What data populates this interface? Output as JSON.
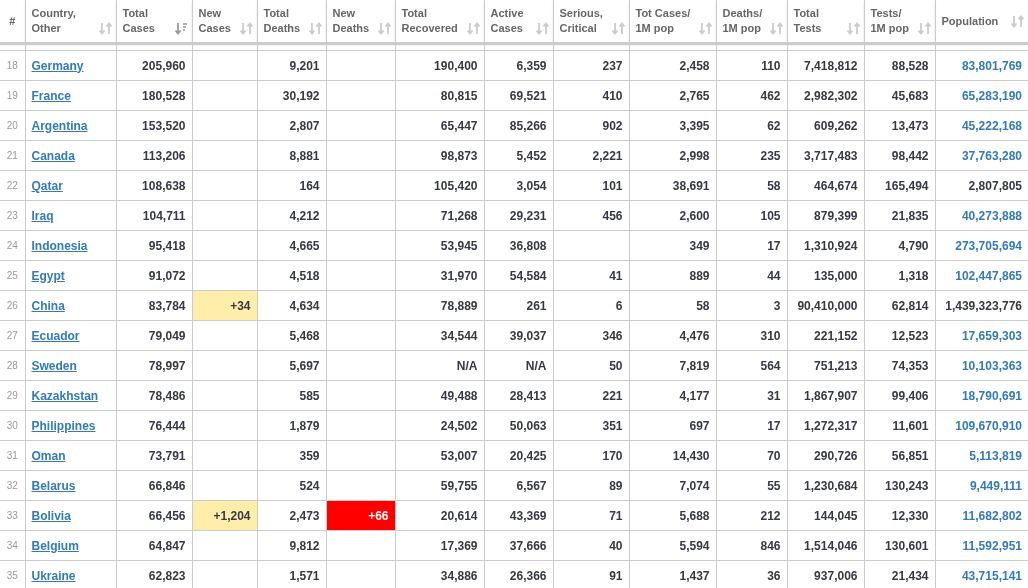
{
  "table": {
    "columns": [
      {
        "label": "#",
        "sortable": false
      },
      {
        "label": "Country,\nOther",
        "sortable": true,
        "sorted": false
      },
      {
        "label": "Total\nCases",
        "sortable": true,
        "sorted": true
      },
      {
        "label": "New\nCases",
        "sortable": true,
        "sorted": false
      },
      {
        "label": "Total\nDeaths",
        "sortable": true,
        "sorted": false
      },
      {
        "label": "New\nDeaths",
        "sortable": true,
        "sorted": false
      },
      {
        "label": "Total\nRecovered",
        "sortable": true,
        "sorted": false
      },
      {
        "label": "Active\nCases",
        "sortable": true,
        "sorted": false
      },
      {
        "label": "Serious,\nCritical",
        "sortable": true,
        "sorted": false
      },
      {
        "label": "Tot Cases/\n1M pop",
        "sortable": true,
        "sorted": false
      },
      {
        "label": "Deaths/\n1M pop",
        "sortable": true,
        "sorted": false
      },
      {
        "label": "Total\nTests",
        "sortable": true,
        "sorted": false
      },
      {
        "label": "Tests/\n1M pop",
        "sortable": true,
        "sorted": false
      },
      {
        "label": "Population",
        "sortable": true,
        "sorted": false
      }
    ],
    "rows": [
      {
        "rank": "18",
        "country": "Germany",
        "total_cases": "205,960",
        "total_deaths": "9,201",
        "total_recovered": "190,400",
        "active_cases": "6,359",
        "serious_critical": "237",
        "cases_per_1m": "2,458",
        "deaths_per_1m": "110",
        "total_tests": "7,418,812",
        "tests_per_1m": "88,528",
        "population": "83,801,769",
        "population_link": true
      },
      {
        "rank": "19",
        "country": "France",
        "total_cases": "180,528",
        "total_deaths": "30,192",
        "total_recovered": "80,815",
        "active_cases": "69,521",
        "serious_critical": "410",
        "cases_per_1m": "2,765",
        "deaths_per_1m": "462",
        "total_tests": "2,982,302",
        "tests_per_1m": "45,683",
        "population": "65,283,190",
        "population_link": true
      },
      {
        "rank": "20",
        "country": "Argentina",
        "total_cases": "153,520",
        "total_deaths": "2,807",
        "total_recovered": "65,447",
        "active_cases": "85,266",
        "serious_critical": "902",
        "cases_per_1m": "3,395",
        "deaths_per_1m": "62",
        "total_tests": "609,262",
        "tests_per_1m": "13,473",
        "population": "45,222,168",
        "population_link": true
      },
      {
        "rank": "21",
        "country": "Canada",
        "total_cases": "113,206",
        "total_deaths": "8,881",
        "total_recovered": "98,873",
        "active_cases": "5,452",
        "serious_critical": "2,221",
        "cases_per_1m": "2,998",
        "deaths_per_1m": "235",
        "total_tests": "3,717,483",
        "tests_per_1m": "98,442",
        "population": "37,763,280",
        "population_link": true
      },
      {
        "rank": "22",
        "country": "Qatar",
        "total_cases": "108,638",
        "total_deaths": "164",
        "total_recovered": "105,420",
        "active_cases": "3,054",
        "serious_critical": "101",
        "cases_per_1m": "38,691",
        "deaths_per_1m": "58",
        "total_tests": "464,674",
        "tests_per_1m": "165,494",
        "population": "2,807,805",
        "population_link": false
      },
      {
        "rank": "23",
        "country": "Iraq",
        "total_cases": "104,711",
        "total_deaths": "4,212",
        "total_recovered": "71,268",
        "active_cases": "29,231",
        "serious_critical": "456",
        "cases_per_1m": "2,600",
        "deaths_per_1m": "105",
        "total_tests": "879,399",
        "tests_per_1m": "21,835",
        "population": "40,273,888",
        "population_link": true
      },
      {
        "rank": "24",
        "country": "Indonesia",
        "total_cases": "95,418",
        "total_deaths": "4,665",
        "total_recovered": "53,945",
        "active_cases": "36,808",
        "cases_per_1m": "349",
        "deaths_per_1m": "17",
        "total_tests": "1,310,924",
        "tests_per_1m": "4,790",
        "population": "273,705,694",
        "population_link": true
      },
      {
        "rank": "25",
        "country": "Egypt",
        "total_cases": "91,072",
        "total_deaths": "4,518",
        "total_recovered": "31,970",
        "active_cases": "54,584",
        "serious_critical": "41",
        "cases_per_1m": "889",
        "deaths_per_1m": "44",
        "total_tests": "135,000",
        "tests_per_1m": "1,318",
        "population": "102,447,865",
        "population_link": true
      },
      {
        "rank": "26",
        "country": "China",
        "total_cases": "83,784",
        "new_cases": "+34",
        "total_deaths": "4,634",
        "total_recovered": "78,889",
        "active_cases": "261",
        "serious_critical": "6",
        "cases_per_1m": "58",
        "deaths_per_1m": "3",
        "total_tests": "90,410,000",
        "tests_per_1m": "62,814",
        "population": "1,439,323,776",
        "population_link": false
      },
      {
        "rank": "27",
        "country": "Ecuador",
        "total_cases": "79,049",
        "total_deaths": "5,468",
        "total_recovered": "34,544",
        "active_cases": "39,037",
        "serious_critical": "346",
        "cases_per_1m": "4,476",
        "deaths_per_1m": "310",
        "total_tests": "221,152",
        "tests_per_1m": "12,523",
        "population": "17,659,303",
        "population_link": true
      },
      {
        "rank": "28",
        "country": "Sweden",
        "total_cases": "78,997",
        "total_deaths": "5,697",
        "total_recovered": "N/A",
        "active_cases": "N/A",
        "serious_critical": "50",
        "cases_per_1m": "7,819",
        "deaths_per_1m": "564",
        "total_tests": "751,213",
        "tests_per_1m": "74,353",
        "population": "10,103,363",
        "population_link": true
      },
      {
        "rank": "29",
        "country": "Kazakhstan",
        "total_cases": "78,486",
        "total_deaths": "585",
        "total_recovered": "49,488",
        "active_cases": "28,413",
        "serious_critical": "221",
        "cases_per_1m": "4,177",
        "deaths_per_1m": "31",
        "total_tests": "1,867,907",
        "tests_per_1m": "99,406",
        "population": "18,790,691",
        "population_link": true
      },
      {
        "rank": "30",
        "country": "Philippines",
        "total_cases": "76,444",
        "total_deaths": "1,879",
        "total_recovered": "24,502",
        "active_cases": "50,063",
        "serious_critical": "351",
        "cases_per_1m": "697",
        "deaths_per_1m": "17",
        "total_tests": "1,272,317",
        "tests_per_1m": "11,601",
        "population": "109,670,910",
        "population_link": true
      },
      {
        "rank": "31",
        "country": "Oman",
        "total_cases": "73,791",
        "total_deaths": "359",
        "total_recovered": "53,007",
        "active_cases": "20,425",
        "serious_critical": "170",
        "cases_per_1m": "14,430",
        "deaths_per_1m": "70",
        "total_tests": "290,726",
        "tests_per_1m": "56,851",
        "population": "5,113,819",
        "population_link": true
      },
      {
        "rank": "32",
        "country": "Belarus",
        "total_cases": "66,846",
        "total_deaths": "524",
        "total_recovered": "59,755",
        "active_cases": "6,567",
        "serious_critical": "89",
        "cases_per_1m": "7,074",
        "deaths_per_1m": "55",
        "total_tests": "1,230,684",
        "tests_per_1m": "130,243",
        "population": "9,449,111",
        "population_link": true
      },
      {
        "rank": "33",
        "country": "Bolivia",
        "total_cases": "66,456",
        "new_cases": "+1,204",
        "total_deaths": "2,473",
        "new_deaths": "+66",
        "total_recovered": "20,614",
        "active_cases": "43,369",
        "serious_critical": "71",
        "cases_per_1m": "5,688",
        "deaths_per_1m": "212",
        "total_tests": "144,045",
        "tests_per_1m": "12,330",
        "population": "11,682,802",
        "population_link": true
      },
      {
        "rank": "34",
        "country": "Belgium",
        "total_cases": "64,847",
        "total_deaths": "9,812",
        "total_recovered": "17,369",
        "active_cases": "37,666",
        "serious_critical": "40",
        "cases_per_1m": "5,594",
        "deaths_per_1m": "846",
        "total_tests": "1,514,046",
        "tests_per_1m": "130,601",
        "population": "11,592,951",
        "population_link": true
      },
      {
        "rank": "35",
        "country": "Ukraine",
        "total_cases": "62,823",
        "total_deaths": "1,571",
        "total_recovered": "34,886",
        "active_cases": "26,366",
        "serious_critical": "91",
        "cases_per_1m": "1,437",
        "deaths_per_1m": "36",
        "total_tests": "937,006",
        "tests_per_1m": "21,434",
        "population": "43,715,141",
        "population_link": true
      }
    ]
  }
}
